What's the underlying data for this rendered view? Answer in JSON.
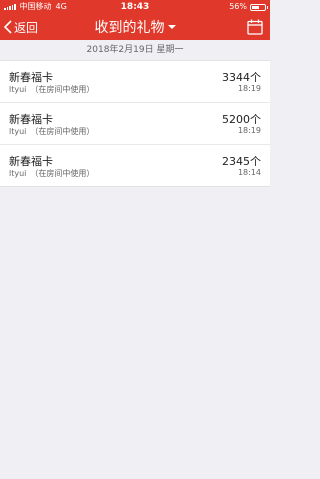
{
  "status_bar": {
    "carrier": "中国移动",
    "network": "4G",
    "time": "18:43",
    "battery_text": "56%",
    "battery_level": 0.56
  },
  "nav": {
    "back_label": "返回",
    "title": "收到的礼物",
    "calendar_icon": "calendar-icon"
  },
  "date_header": "2018年2月19日 星期一",
  "gifts": [
    {
      "name": "新春福卡",
      "sender": "ltyui",
      "context": "（在房间中使用）",
      "count": "3344个",
      "time": "18:19"
    },
    {
      "name": "新春福卡",
      "sender": "ltyui",
      "context": "（在房间中使用）",
      "count": "5200个",
      "time": "18:19"
    },
    {
      "name": "新春福卡",
      "sender": "ltyui",
      "context": "（在房间中使用）",
      "count": "2345个",
      "time": "18:14"
    }
  ],
  "colors": {
    "accent": "#e0392b",
    "background": "#efeff4"
  }
}
